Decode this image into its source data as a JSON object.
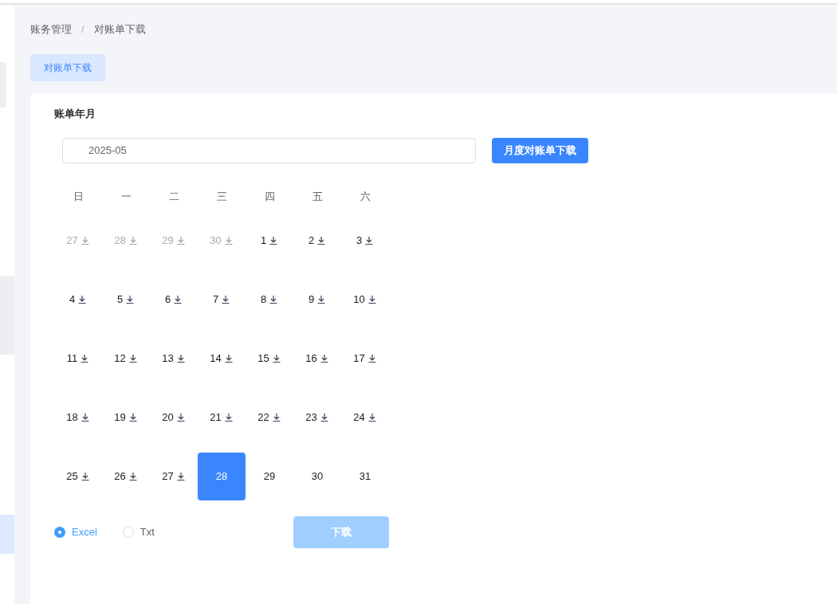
{
  "sidebar": {
    "items": [
      {
        "selected": false
      },
      {
        "selected": false
      },
      {
        "selected": true
      }
    ]
  },
  "breadcrumb": [
    "账务管理",
    "对账单下载"
  ],
  "breadcrumb_separator": "/",
  "tabs": [
    {
      "label": "对账单下载",
      "selected": true
    }
  ],
  "form": {
    "label": "账单年月",
    "month_field": {
      "value": "2025-05"
    },
    "month_button": "月度对账单下载"
  },
  "calendar": {
    "weekdays": [
      "日",
      "一",
      "二",
      "三",
      "四",
      "五",
      "六"
    ],
    "days": [
      {
        "label": "27",
        "muted": true,
        "downloadable": true,
        "selected": false
      },
      {
        "label": "28",
        "muted": true,
        "downloadable": true,
        "selected": false
      },
      {
        "label": "29",
        "muted": true,
        "downloadable": true,
        "selected": false
      },
      {
        "label": "30",
        "muted": true,
        "downloadable": true,
        "selected": false
      },
      {
        "label": "1",
        "muted": false,
        "downloadable": true,
        "selected": false
      },
      {
        "label": "2",
        "muted": false,
        "downloadable": true,
        "selected": false
      },
      {
        "label": "3",
        "muted": false,
        "downloadable": true,
        "selected": false
      },
      {
        "label": "4",
        "muted": false,
        "downloadable": true,
        "selected": false
      },
      {
        "label": "5",
        "muted": false,
        "downloadable": true,
        "selected": false
      },
      {
        "label": "6",
        "muted": false,
        "downloadable": true,
        "selected": false
      },
      {
        "label": "7",
        "muted": false,
        "downloadable": true,
        "selected": false
      },
      {
        "label": "8",
        "muted": false,
        "downloadable": true,
        "selected": false
      },
      {
        "label": "9",
        "muted": false,
        "downloadable": true,
        "selected": false
      },
      {
        "label": "10",
        "muted": false,
        "downloadable": true,
        "selected": false
      },
      {
        "label": "11",
        "muted": false,
        "downloadable": true,
        "selected": false
      },
      {
        "label": "12",
        "muted": false,
        "downloadable": true,
        "selected": false
      },
      {
        "label": "13",
        "muted": false,
        "downloadable": true,
        "selected": false
      },
      {
        "label": "14",
        "muted": false,
        "downloadable": true,
        "selected": false
      },
      {
        "label": "15",
        "muted": false,
        "downloadable": true,
        "selected": false
      },
      {
        "label": "16",
        "muted": false,
        "downloadable": true,
        "selected": false
      },
      {
        "label": "17",
        "muted": false,
        "downloadable": true,
        "selected": false
      },
      {
        "label": "18",
        "muted": false,
        "downloadable": true,
        "selected": false
      },
      {
        "label": "19",
        "muted": false,
        "downloadable": true,
        "selected": false
      },
      {
        "label": "20",
        "muted": false,
        "downloadable": true,
        "selected": false
      },
      {
        "label": "21",
        "muted": false,
        "downloadable": true,
        "selected": false
      },
      {
        "label": "22",
        "muted": false,
        "downloadable": true,
        "selected": false
      },
      {
        "label": "23",
        "muted": false,
        "downloadable": true,
        "selected": false
      },
      {
        "label": "24",
        "muted": false,
        "downloadable": true,
        "selected": false
      },
      {
        "label": "25",
        "muted": false,
        "downloadable": true,
        "selected": false
      },
      {
        "label": "26",
        "muted": false,
        "downloadable": true,
        "selected": false
      },
      {
        "label": "27",
        "muted": false,
        "downloadable": true,
        "selected": false
      },
      {
        "label": "28",
        "muted": false,
        "downloadable": false,
        "selected": true
      },
      {
        "label": "29",
        "muted": false,
        "downloadable": false,
        "selected": false
      },
      {
        "label": "30",
        "muted": false,
        "downloadable": false,
        "selected": false
      },
      {
        "label": "31",
        "muted": false,
        "downloadable": false,
        "selected": false
      }
    ]
  },
  "formats": [
    {
      "label": "Excel",
      "selected": true
    },
    {
      "label": "Txt",
      "selected": false
    }
  ],
  "download_button": {
    "label": "下载",
    "disabled": true
  }
}
